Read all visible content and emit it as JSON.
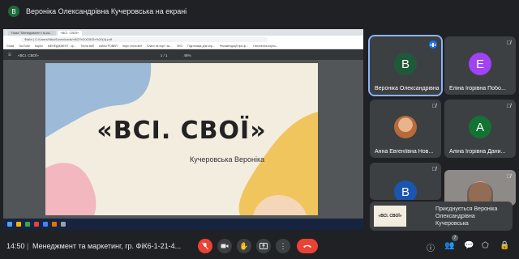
{
  "presenter": {
    "initial": "B",
    "text": "Вероніка Олександрівна Кучеровська на екрані"
  },
  "shared_screen": {
    "browser": {
      "tabs": [
        "Нова \"Менеджмент і м-ка...",
        "«ВСІ. СВОЇ»"
      ],
      "address": "Файл | C:/Users/Nika/Downloads/«ВСІ%20СВОЇ»%20(4).pdf",
      "bookmarks": [
        "Gmail",
        "YouTube",
        "Карты",
        "МЕНЕДЖМЕНТ - ф...",
        "Тесты веб",
        "сайты POBER",
        "Інфо чтось веб",
        "Благо на порт. за...",
        "ЗНО",
        "Підготовка для сер...",
        "Рекомендації при ф...",
        "Натхнення корпо..."
      ]
    },
    "pdf": {
      "title": "«ВСІ. СВОЇ»",
      "page": "1 / 1",
      "zoom": "46%"
    },
    "slide": {
      "title": "«ВСІ. СВОЇ»",
      "author": "Кучеровська Вероніка"
    }
  },
  "participants": [
    {
      "initial": "B",
      "name": "Вероніка Олександрівна...",
      "color": "#1e5a3a",
      "speaking": true
    },
    {
      "initial": "E",
      "name": "Еліна Ігорівна Побо...",
      "color": "#a142f4",
      "speaking": false
    },
    {
      "initial": "",
      "name": "Анна Евгеніївна Нов...",
      "color": "#3c4043",
      "speaking": false
    },
    {
      "initial": "A",
      "name": "Аліна Ігорівна Дани...",
      "color": "#137333",
      "speaking": false
    },
    {
      "initial": "B",
      "name": "",
      "color": "#1a56b0",
      "speaking": false
    }
  ],
  "toast": {
    "thumb_title": "«ВСІ. СВОЇ»",
    "line1": "Приєднується Вероніка",
    "line2": "Олександрівна",
    "line3": "Кучеровська"
  },
  "bottombar": {
    "time": "14:50",
    "separator": "|",
    "meeting": "Менеджмент та маркетинг, гр. ФіК6-1-21-4...",
    "participant_count": "7"
  },
  "colors": {
    "accent": "#8ab4f8",
    "end_call": "#ea4335",
    "background": "#202124"
  }
}
